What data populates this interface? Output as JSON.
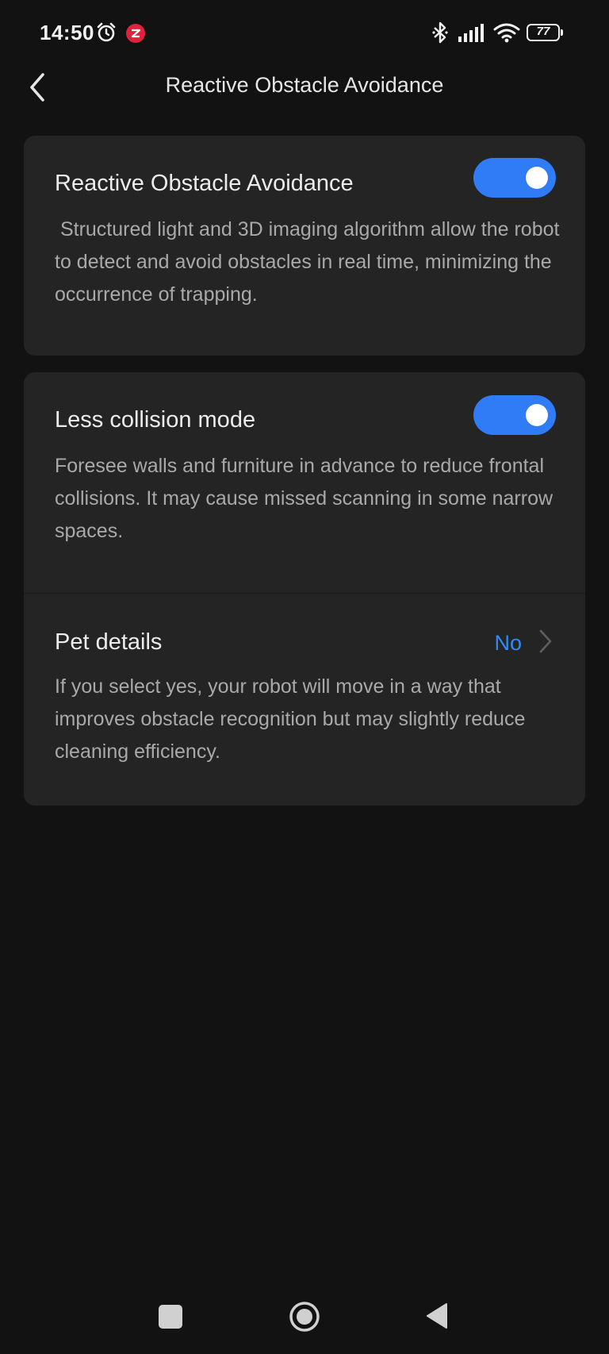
{
  "status_bar": {
    "time": "14:50",
    "battery_level": "77",
    "icons": [
      "alarm-icon",
      "app-notification-icon",
      "bluetooth-icon",
      "signal-icon",
      "wifi-icon",
      "battery-icon"
    ]
  },
  "header": {
    "title": "Reactive Obstacle Avoidance",
    "back_icon": "chevron-left-icon"
  },
  "settings": {
    "obstacle_avoidance": {
      "title": "Reactive Obstacle Avoidance",
      "description": " Structured light and 3D imaging algorithm allow the robot to detect and avoid obstacles in real time, minimizing the occurrence of trapping.",
      "enabled": true
    },
    "less_collision": {
      "title": "Less collision mode",
      "description": "Foresee walls and furniture in advance to reduce frontal collisions. It may cause missed scanning in some narrow spaces.",
      "enabled": true
    },
    "pet_details": {
      "title": "Pet details",
      "value": "No",
      "description": "If you select yes, your robot will move in a way that improves obstacle recognition but may slightly reduce cleaning efficiency."
    }
  },
  "colors": {
    "background": "#121212",
    "card": "#242424",
    "accent": "#2f7cf6",
    "link": "#2f8cf5",
    "title_text": "#ececec",
    "secondary_text": "#a9a9a9"
  },
  "nav_bar": {
    "icons": [
      "recent-apps-icon",
      "home-icon",
      "back-triangle-icon"
    ]
  }
}
